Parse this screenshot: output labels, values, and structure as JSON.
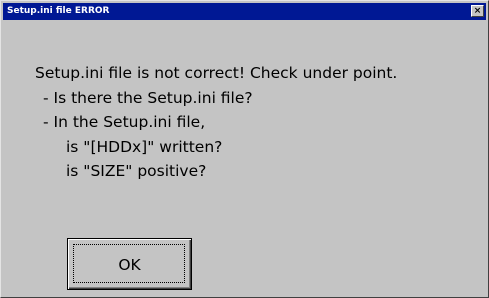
{
  "window": {
    "title": "Setup.ini file ERROR",
    "close_glyph": "×"
  },
  "message": {
    "lines": [
      "Setup.ini file is not correct! Check under point.",
      "- Is there the Setup.ini file?",
      "- In the Setup.ini file,",
      "is \"[HDDx]\" written?",
      "is \"SIZE\" positive?"
    ]
  },
  "buttons": {
    "ok_label": "OK"
  },
  "icons": {
    "close": "close-icon"
  },
  "colors": {
    "titlebar": "#001894",
    "dialog_face": "#c4c4c4",
    "title_text": "#ffffff"
  }
}
